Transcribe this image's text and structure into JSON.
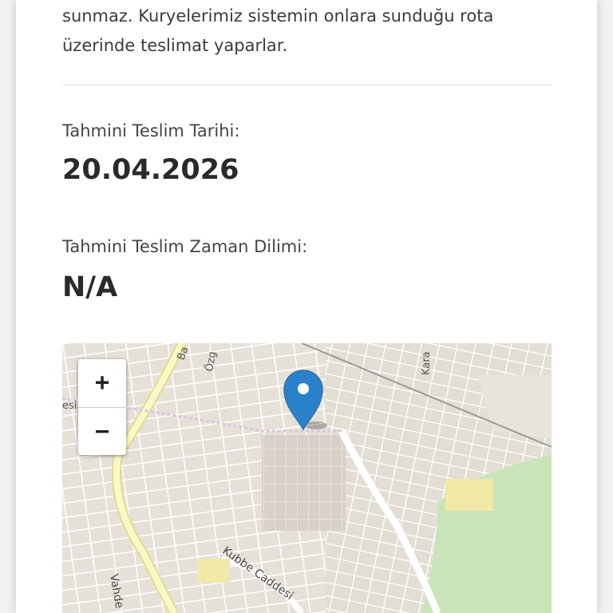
{
  "delivery": {
    "intro_text": "sunmaz. Kuryelerimiz sistemin onlara sunduğu rota üzerinde teslimat yaparlar.",
    "date_label": "Tahmini Teslim Tarihi:",
    "date_value": "20.04.2026",
    "slot_label": "Tahmini Teslim Zaman Dilimi:",
    "slot_value": "N/A"
  },
  "map": {
    "zoom_in_label": "+",
    "zoom_out_label": "−",
    "street_labels": {
      "ba": "Ba",
      "ozg": "Özg",
      "kara": "Kara",
      "esi": "esi",
      "kubbe": "Kubbe Caddesi",
      "vahde": "Vahde"
    },
    "marker_icon": "map-pin-icon",
    "colors": {
      "marker": "#2a81cb",
      "major_road": "#f7f9c8",
      "park": "#c8e4b8",
      "land": "#f2efe9"
    }
  }
}
